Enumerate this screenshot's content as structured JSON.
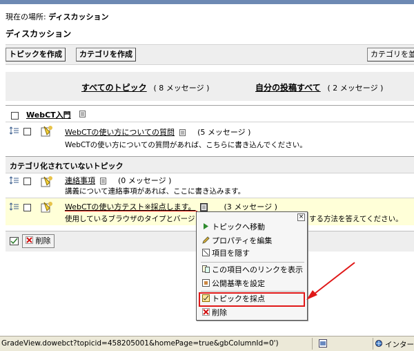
{
  "location": {
    "label": "現在の場所:",
    "current": "ディスカッション"
  },
  "page_title": "ディスカッション",
  "toolbar": {
    "create_topic": "トピックを作成",
    "create_category": "カテゴリを作成",
    "sort_categories": "カテゴリを並"
  },
  "summary": {
    "all_topics": "すべてのトピック",
    "all_topics_count": "( 8 メッセージ )",
    "my_posts": "自分の投稿すべて",
    "my_posts_count": "( 2 メッセージ )"
  },
  "category1": {
    "title": "WebCT入門",
    "topic": {
      "title": "WebCTの使い方についての質問",
      "count": "(5 メッセージ )",
      "desc": "WebCTの使い方についての質問があれば、こちらに書き込んでください。"
    }
  },
  "uncategorized": {
    "title": "カテゴリ化されていないトピック",
    "topic1": {
      "title": "連絡事項",
      "count": "(0 メッセージ )",
      "desc": "講義について連絡事項があれば、ここに書き込みます。"
    },
    "topic2": {
      "title": "WebCTの使い方テスト※採点します。",
      "count": "(3 メッセージ )",
      "desc_left": "使用しているブラウザのタイプとバージョン",
      "desc_right": "する方法を答えてください。"
    }
  },
  "bottom": {
    "delete": "削除"
  },
  "context_menu": {
    "items": [
      "トピックへ移動",
      "プロパティを編集",
      "項目を隠す",
      "この項目へのリンクを表示",
      "公開基準を設定",
      "トピックを採点",
      "削除"
    ]
  },
  "status": {
    "url": "GradeView.dowebct?topicid=458205001&homePage=true&gbColumnId=0')",
    "zone": "インター"
  },
  "colors": {
    "highlight_red": "#e01818",
    "arrow_red": "#e01818",
    "row_highlight": "#ffffd8",
    "toolbar_gray": "#eeeeee"
  }
}
